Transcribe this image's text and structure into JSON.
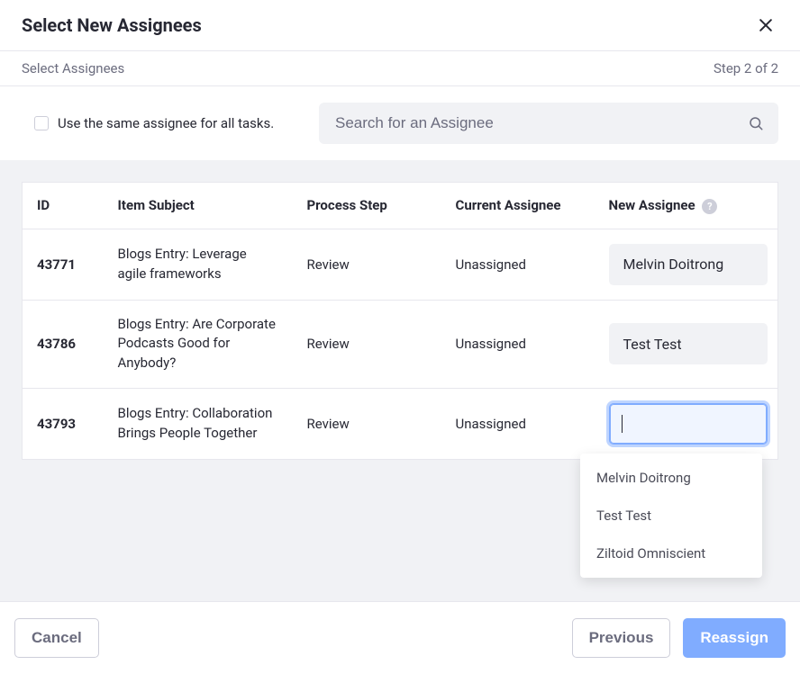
{
  "modal": {
    "title": "Select New Assignees",
    "step_left": "Select Assignees",
    "step_right": "Step 2 of 2"
  },
  "controls": {
    "checkbox_label": "Use the same assignee for all tasks.",
    "search_placeholder": "Search for an Assignee"
  },
  "table": {
    "headers": {
      "id": "ID",
      "subject": "Item Subject",
      "step": "Process Step",
      "current": "Current Assignee",
      "new": "New Assignee"
    },
    "rows": [
      {
        "id": "43771",
        "subject": "Blogs Entry: Leverage agile frameworks",
        "step": "Review",
        "current": "Unassigned",
        "new_assignee": "Melvin Doitrong"
      },
      {
        "id": "43786",
        "subject": "Blogs Entry: Are Corporate Podcasts Good for Anybody?",
        "step": "Review",
        "current": "Unassigned",
        "new_assignee": "Test Test"
      },
      {
        "id": "43793",
        "subject": "Blogs Entry: Collaboration Brings People Together",
        "step": "Review",
        "current": "Unassigned",
        "new_assignee": ""
      }
    ]
  },
  "dropdown": {
    "options": [
      "Melvin Doitrong",
      "Test Test",
      "Ziltoid Omniscient"
    ]
  },
  "footer": {
    "cancel": "Cancel",
    "previous": "Previous",
    "reassign": "Reassign"
  }
}
